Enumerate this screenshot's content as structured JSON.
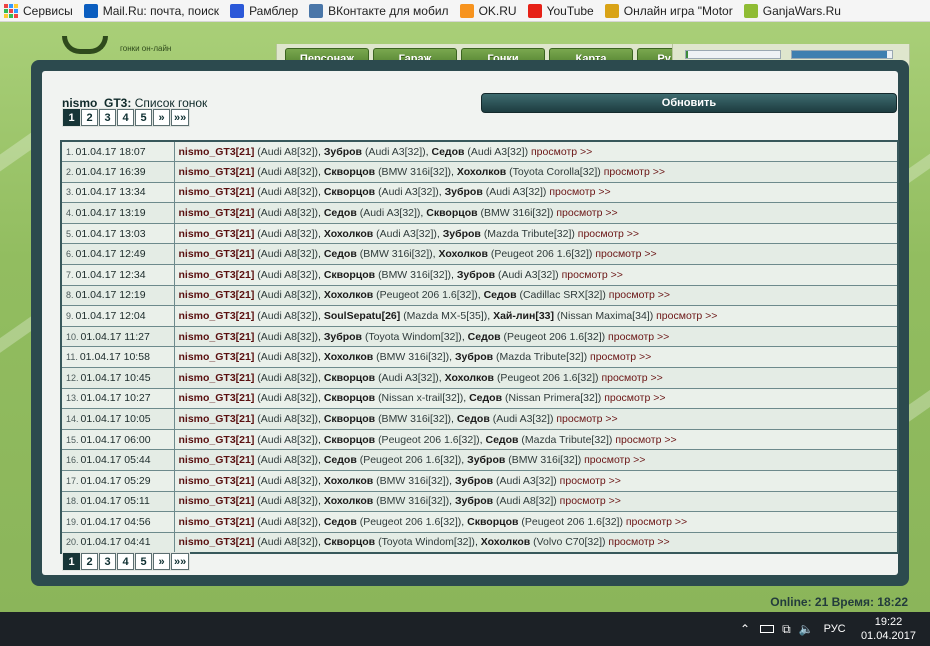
{
  "bookmarks": [
    {
      "label": "Сервисы",
      "icon": "apps-icon",
      "color": "#e44"
    },
    {
      "label": "Mail.Ru: почта, поиск",
      "icon": "mailru-icon",
      "color": "#0a5dbf"
    },
    {
      "label": "Рамблер",
      "icon": "rambler-icon",
      "color": "#2b58d8"
    },
    {
      "label": "ВКонтакте для мобил",
      "icon": "vk-icon",
      "color": "#4a76a8"
    },
    {
      "label": "OK.RU",
      "icon": "ok-icon",
      "color": "#f7931e"
    },
    {
      "label": "YouTube",
      "icon": "youtube-icon",
      "color": "#e62117"
    },
    {
      "label": "Онлайн игра \"Motor",
      "icon": "game-icon",
      "color": "#d9a316"
    },
    {
      "label": "GanjaWars.Ru",
      "icon": "ganjawars-icon",
      "color": "#8fbc34"
    }
  ],
  "header": {
    "logo_text": "гонки он-лайн",
    "nav": [
      "Персонаж",
      "Гараж",
      "Гонки",
      "Карта",
      "Рулетка"
    ],
    "bars": [
      {
        "fill": 0.02,
        "color": "#3a8a3a"
      },
      {
        "fill": 0.95,
        "color": "#3f7fb0"
      }
    ]
  },
  "page": {
    "user": "nismo_GT3:",
    "title": "Список гонок",
    "refresh_label": "Обновить",
    "pages": [
      "1",
      "2",
      "3",
      "4",
      "5",
      "»",
      "»»"
    ],
    "active_page": "1",
    "view_label": "просмотр >>"
  },
  "races": [
    {
      "n": "1.",
      "date": "01.04.17 18:07",
      "racers": [
        [
          "nismo_GT3[21]",
          "(Audi A8[32])"
        ],
        [
          "Зубров",
          "(Audi A3[32])"
        ],
        [
          "Седов",
          "(Audi A3[32])"
        ]
      ]
    },
    {
      "n": "2.",
      "date": "01.04.17 16:39",
      "racers": [
        [
          "nismo_GT3[21]",
          "(Audi A8[32])"
        ],
        [
          "Скворцов",
          "(BMW 316i[32])"
        ],
        [
          "Хохолков",
          "(Toyota Corolla[32])"
        ]
      ]
    },
    {
      "n": "3.",
      "date": "01.04.17 13:34",
      "racers": [
        [
          "nismo_GT3[21]",
          "(Audi A8[32])"
        ],
        [
          "Скворцов",
          "(Audi A3[32])"
        ],
        [
          "Зубров",
          "(Audi A3[32])"
        ]
      ]
    },
    {
      "n": "4.",
      "date": "01.04.17 13:19",
      "racers": [
        [
          "nismo_GT3[21]",
          "(Audi A8[32])"
        ],
        [
          "Седов",
          "(Audi A3[32])"
        ],
        [
          "Скворцов",
          "(BMW 316i[32])"
        ]
      ]
    },
    {
      "n": "5.",
      "date": "01.04.17 13:03",
      "racers": [
        [
          "nismo_GT3[21]",
          "(Audi A8[32])"
        ],
        [
          "Хохолков",
          "(Audi A3[32])"
        ],
        [
          "Зубров",
          "(Mazda Tribute[32])"
        ]
      ]
    },
    {
      "n": "6.",
      "date": "01.04.17 12:49",
      "racers": [
        [
          "nismo_GT3[21]",
          "(Audi A8[32])"
        ],
        [
          "Седов",
          "(BMW 316i[32])"
        ],
        [
          "Хохолков",
          "(Peugeot 206 1.6[32])"
        ]
      ]
    },
    {
      "n": "7.",
      "date": "01.04.17 12:34",
      "racers": [
        [
          "nismo_GT3[21]",
          "(Audi A8[32])"
        ],
        [
          "Скворцов",
          "(BMW 316i[32])"
        ],
        [
          "Зубров",
          "(Audi A3[32])"
        ]
      ]
    },
    {
      "n": "8.",
      "date": "01.04.17 12:19",
      "racers": [
        [
          "nismo_GT3[21]",
          "(Audi A8[32])"
        ],
        [
          "Хохолков",
          "(Peugeot 206 1.6[32])"
        ],
        [
          "Седов",
          "(Cadillac SRX[32])"
        ]
      ]
    },
    {
      "n": "9.",
      "date": "01.04.17 12:04",
      "racers": [
        [
          "nismo_GT3[21]",
          "(Audi A8[32])"
        ],
        [
          "SoulSepatu[26]",
          "(Mazda MX-5[35])"
        ],
        [
          "Хай-лин[33]",
          "(Nissan Maxima[34])"
        ]
      ]
    },
    {
      "n": "10.",
      "date": "01.04.17 11:27",
      "racers": [
        [
          "nismo_GT3[21]",
          "(Audi A8[32])"
        ],
        [
          "Зубров",
          "(Toyota Windom[32])"
        ],
        [
          "Седов",
          "(Peugeot 206 1.6[32])"
        ]
      ]
    },
    {
      "n": "11.",
      "date": "01.04.17 10:58",
      "racers": [
        [
          "nismo_GT3[21]",
          "(Audi A8[32])"
        ],
        [
          "Хохолков",
          "(BMW 316i[32])"
        ],
        [
          "Зубров",
          "(Mazda Tribute[32])"
        ]
      ]
    },
    {
      "n": "12.",
      "date": "01.04.17 10:45",
      "racers": [
        [
          "nismo_GT3[21]",
          "(Audi A8[32])"
        ],
        [
          "Скворцов",
          "(Audi A3[32])"
        ],
        [
          "Хохолков",
          "(Peugeot 206 1.6[32])"
        ]
      ]
    },
    {
      "n": "13.",
      "date": "01.04.17 10:27",
      "racers": [
        [
          "nismo_GT3[21]",
          "(Audi A8[32])"
        ],
        [
          "Скворцов",
          "(Nissan x-trail[32])"
        ],
        [
          "Седов",
          "(Nissan Primera[32])"
        ]
      ]
    },
    {
      "n": "14.",
      "date": "01.04.17 10:05",
      "racers": [
        [
          "nismo_GT3[21]",
          "(Audi A8[32])"
        ],
        [
          "Скворцов",
          "(BMW 316i[32])"
        ],
        [
          "Седов",
          "(Audi A3[32])"
        ]
      ]
    },
    {
      "n": "15.",
      "date": "01.04.17 06:00",
      "racers": [
        [
          "nismo_GT3[21]",
          "(Audi A8[32])"
        ],
        [
          "Скворцов",
          "(Peugeot 206 1.6[32])"
        ],
        [
          "Седов",
          "(Mazda Tribute[32])"
        ]
      ]
    },
    {
      "n": "16.",
      "date": "01.04.17 05:44",
      "racers": [
        [
          "nismo_GT3[21]",
          "(Audi A8[32])"
        ],
        [
          "Седов",
          "(Peugeot 206 1.6[32])"
        ],
        [
          "Зубров",
          "(BMW 316i[32])"
        ]
      ]
    },
    {
      "n": "17.",
      "date": "01.04.17 05:29",
      "racers": [
        [
          "nismo_GT3[21]",
          "(Audi A8[32])"
        ],
        [
          "Хохолков",
          "(BMW 316i[32])"
        ],
        [
          "Зубров",
          "(Audi A3[32])"
        ]
      ]
    },
    {
      "n": "18.",
      "date": "01.04.17 05:11",
      "racers": [
        [
          "nismo_GT3[21]",
          "(Audi A8[32])"
        ],
        [
          "Хохолков",
          "(BMW 316i[32])"
        ],
        [
          "Зубров",
          "(Audi A8[32])"
        ]
      ]
    },
    {
      "n": "19.",
      "date": "01.04.17 04:56",
      "racers": [
        [
          "nismo_GT3[21]",
          "(Audi A8[32])"
        ],
        [
          "Седов",
          "(Peugeot 206 1.6[32])"
        ],
        [
          "Скворцов",
          "(Peugeot 206 1.6[32])"
        ]
      ]
    },
    {
      "n": "20.",
      "date": "01.04.17 04:41",
      "racers": [
        [
          "nismo_GT3[21]",
          "(Audi A8[32])"
        ],
        [
          "Скворцов",
          "(Toyota Windom[32])"
        ],
        [
          "Хохолков",
          "(Volvo C70[32])"
        ]
      ]
    }
  ],
  "footer": {
    "online": "Online: 21  Время: 18:22"
  },
  "taskbar": {
    "lang": "РУС",
    "time": "19:22",
    "date": "01.04.2017"
  }
}
